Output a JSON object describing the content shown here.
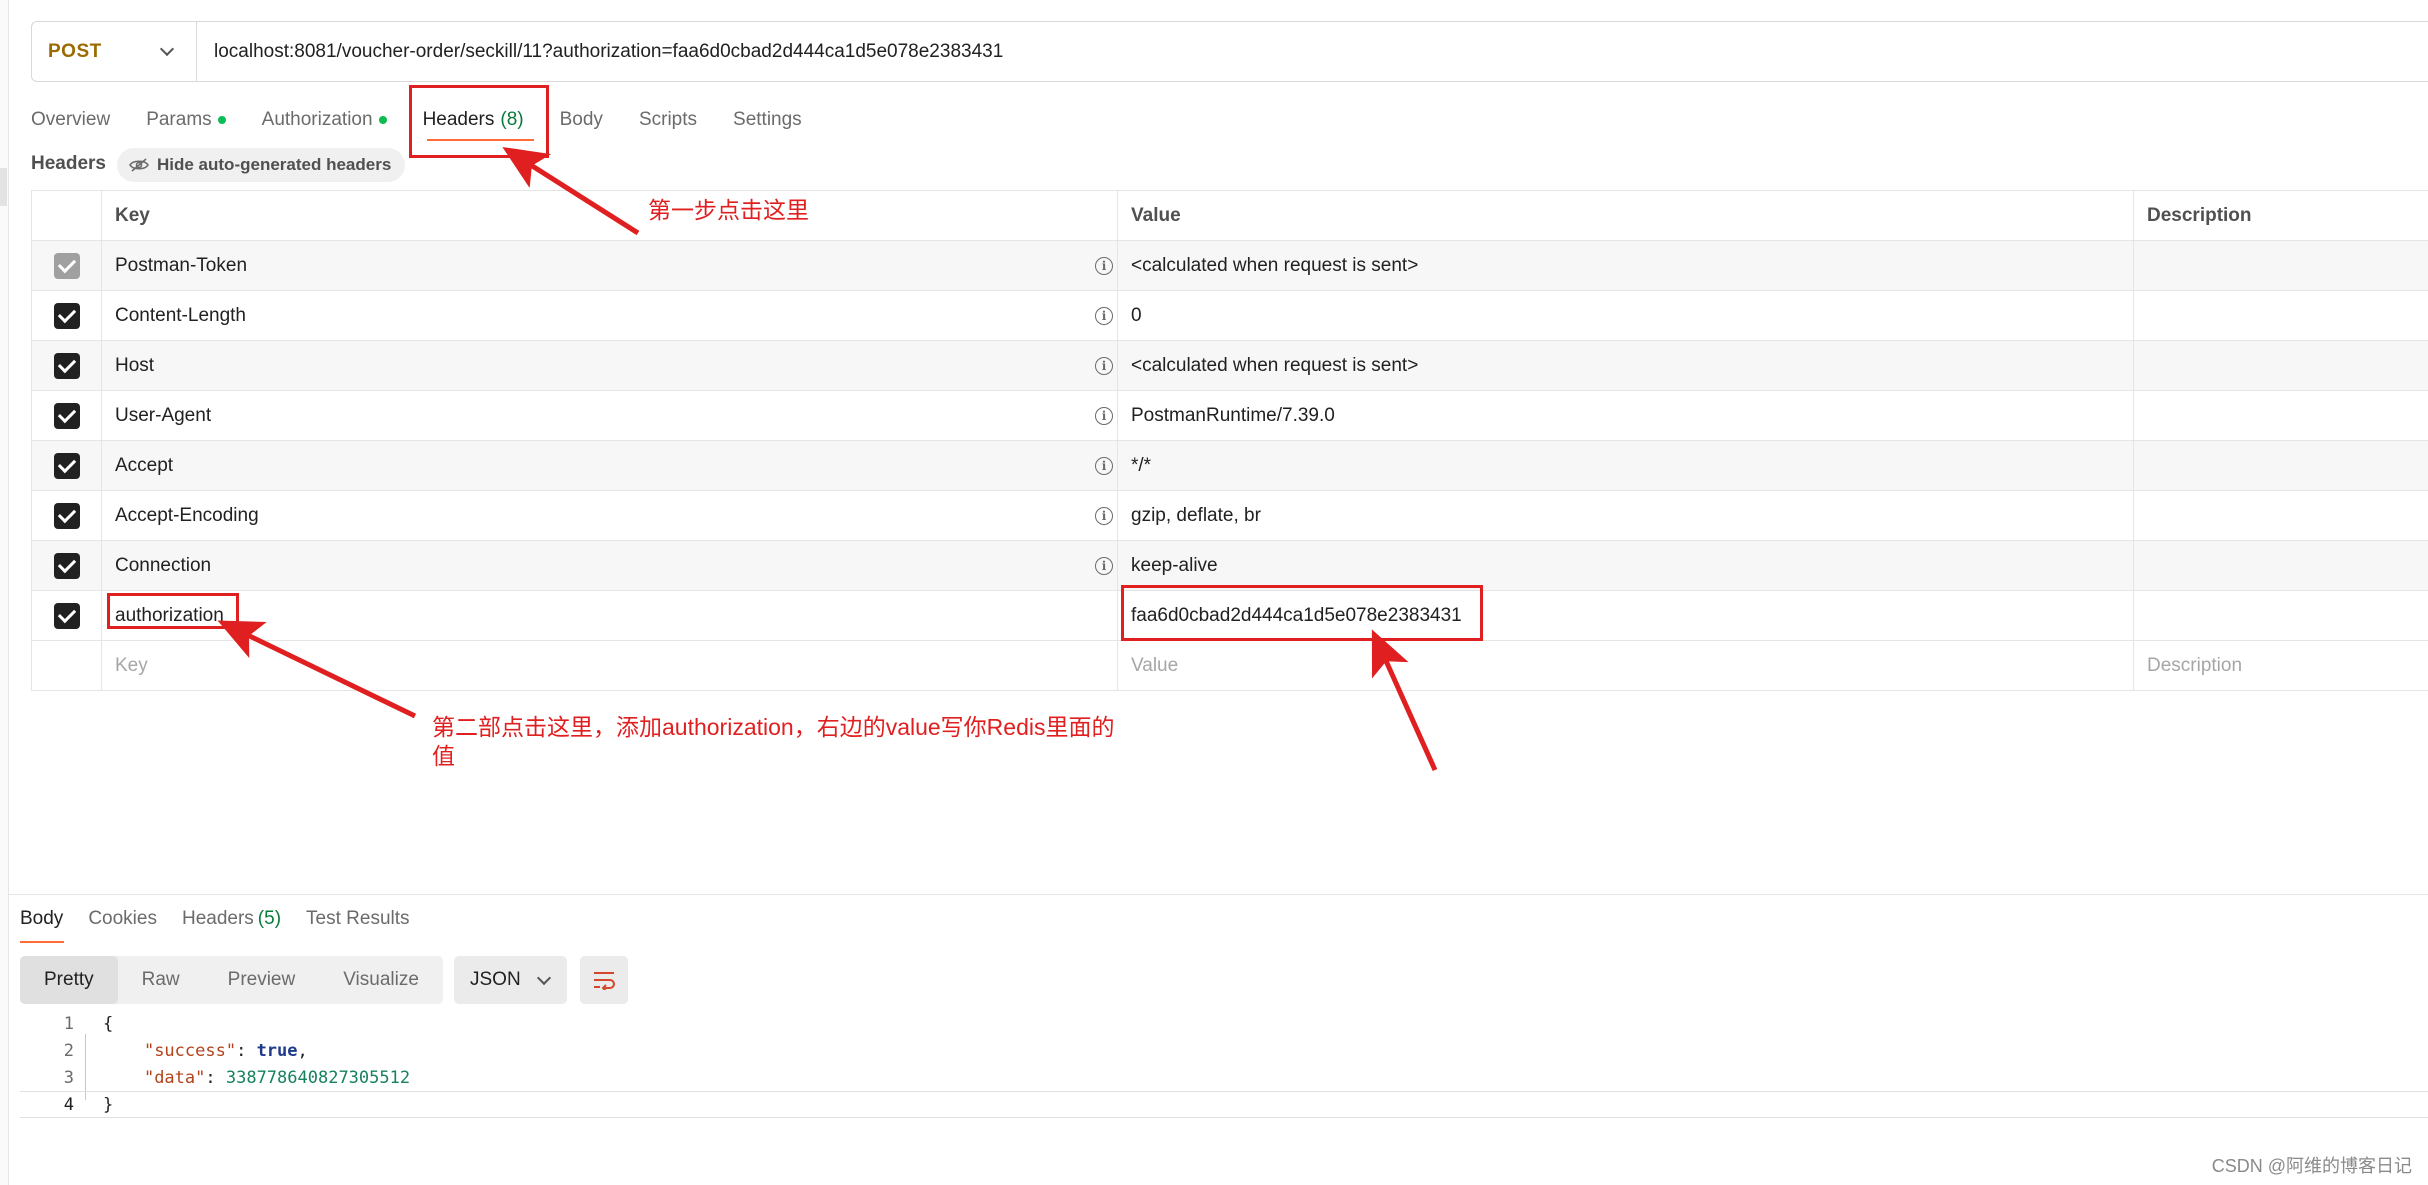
{
  "request": {
    "method": "POST",
    "url": "localhost:8081/voucher-order/seckill/11?authorization=faa6d0cbad2d444ca1d5e078e2383431"
  },
  "request_tabs": [
    {
      "label": "Overview"
    },
    {
      "label": "Params"
    },
    {
      "label": "Authorization"
    },
    {
      "label": "Headers",
      "count": "(8)"
    },
    {
      "label": "Body"
    },
    {
      "label": "Scripts"
    },
    {
      "label": "Settings"
    }
  ],
  "headers_section": {
    "title": "Headers",
    "hide_auto_label": "Hide auto-generated headers"
  },
  "headers_table": {
    "columns": {
      "key": "Key",
      "value": "Value",
      "description": "Description"
    },
    "rows": [
      {
        "key": "Postman-Token",
        "value": "<calculated when request is sent>"
      },
      {
        "key": "Content-Length",
        "value": "0"
      },
      {
        "key": "Host",
        "value": "<calculated when request is sent>"
      },
      {
        "key": "User-Agent",
        "value": "PostmanRuntime/7.39.0"
      },
      {
        "key": "Accept",
        "value": "*/*"
      },
      {
        "key": "Accept-Encoding",
        "value": "gzip, deflate, br"
      },
      {
        "key": "Connection",
        "value": "keep-alive"
      },
      {
        "key": "authorization",
        "value": "faa6d0cbad2d444ca1d5e078e2383431"
      }
    ],
    "new_row": {
      "key_placeholder": "Key",
      "value_placeholder": "Value",
      "description_placeholder": "Description"
    }
  },
  "annotations": {
    "step1": "第一步点击这里",
    "step2_line1": "第二部点击这里，添加authorization，右边的value写你Redis里面的",
    "step2_line2": "值"
  },
  "response": {
    "tabs": [
      {
        "label": "Body"
      },
      {
        "label": "Cookies"
      },
      {
        "label": "Headers",
        "count": "(5)"
      },
      {
        "label": "Test Results"
      }
    ],
    "view_modes": [
      "Pretty",
      "Raw",
      "Preview",
      "Visualize"
    ],
    "format": "JSON",
    "code": {
      "line_numbers": [
        "1",
        "2",
        "3",
        "4"
      ],
      "open_brace": "{",
      "success_key": "\"success\"",
      "success_value": "true",
      "data_key": "\"data\"",
      "data_value": "338778640827305512",
      "close_brace": "}"
    }
  },
  "watermark": "CSDN @阿维的博客日记",
  "colors": {
    "accent": "#ff6c37",
    "annotation": "#e02020",
    "method": "#9b6a00",
    "status_dot": "#0cbb52"
  }
}
